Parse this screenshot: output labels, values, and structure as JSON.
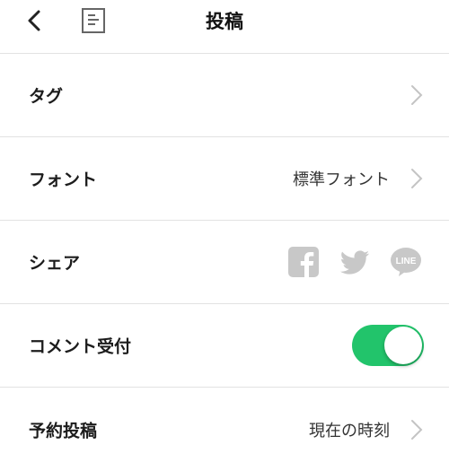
{
  "header": {
    "title": "投稿",
    "back_icon": "chevron-left-icon",
    "doc_icon": "document-icon"
  },
  "settings": {
    "tag": {
      "label": "タグ"
    },
    "font": {
      "label": "フォント",
      "value": "標準フォント"
    },
    "share": {
      "label": "シェア",
      "icons": [
        "facebook-icon",
        "twitter-icon",
        "line-icon"
      ],
      "line_text": "LINE",
      "icon_color": "#c8c8c8"
    },
    "comments": {
      "label": "コメント受付",
      "enabled": true,
      "toggle_color": "#22c46b"
    },
    "schedule": {
      "label": "予約投稿",
      "value": "現在の時刻"
    }
  }
}
